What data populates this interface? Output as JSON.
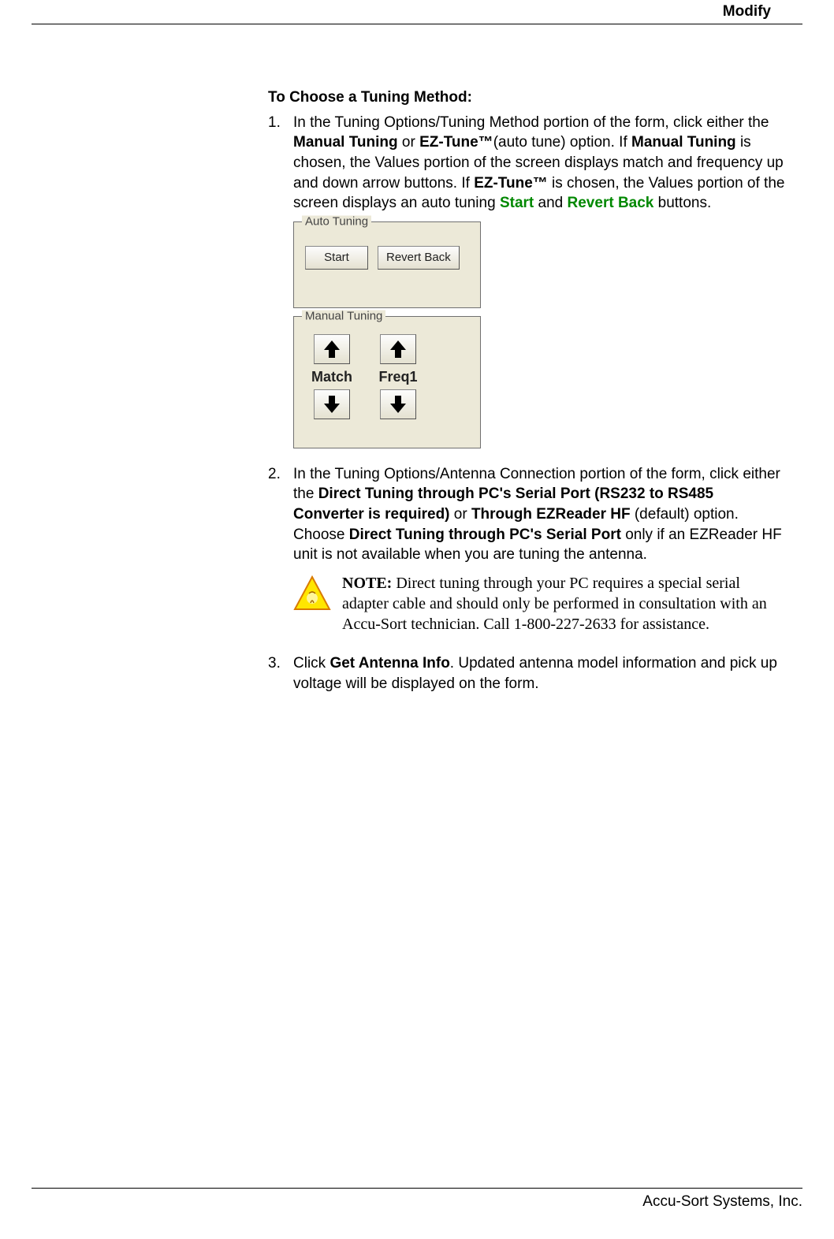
{
  "header": {
    "title": "Modify"
  },
  "section": {
    "heading": "To Choose a Tuning Method:"
  },
  "steps": {
    "s1": {
      "num": "1.",
      "t1": "In the Tuning Options/Tuning Method portion of the form, click either the ",
      "b1": "Manual Tuning",
      "t2": " or ",
      "b2": "EZ-Tune™",
      "t3": "(auto tune) option. If ",
      "b3": "Manual Tuning",
      "t4": " is chosen, the Values portion of the screen displays match and frequency up and down arrow buttons. If ",
      "b4": "EZ-Tune™",
      "t5": " is chosen, the Values portion of the screen displays an auto tuning ",
      "g1": "Start",
      "t6": " and ",
      "g2": "Revert Back",
      "t7": " buttons."
    },
    "s2": {
      "num": "2.",
      "t1": "In the Tuning Options/Antenna Connection portion of the form, click either the ",
      "b1": "Direct Tuning through PC's Serial Port (RS232 to RS485 Converter is required)",
      "t2": " or ",
      "b2": "Through EZReader HF",
      "t3": " (default) option. Choose ",
      "b3": "Direct Tuning through PC's Serial Port",
      "t4": " only if an EZReader HF unit is not available when you are tuning the antenna."
    },
    "s3": {
      "num": "3.",
      "t1": "Click ",
      "b1": "Get Antenna Info",
      "t2": ". Updated antenna model information and pick up voltage will be displayed on the form."
    }
  },
  "autoTuning": {
    "title": "Auto Tuning",
    "start": "Start",
    "revert": "Revert Back"
  },
  "manualTuning": {
    "title": "Manual Tuning",
    "match": "Match",
    "freq": "Freq1"
  },
  "note": {
    "label": "NOTE:",
    "text": " Direct tuning through your PC requires a special serial adapter cable and should only be performed in consultation with an Accu-Sort technician. Call 1-800-227-2633 for assistance."
  },
  "footer": {
    "company": "Accu-Sort Systems, Inc."
  }
}
